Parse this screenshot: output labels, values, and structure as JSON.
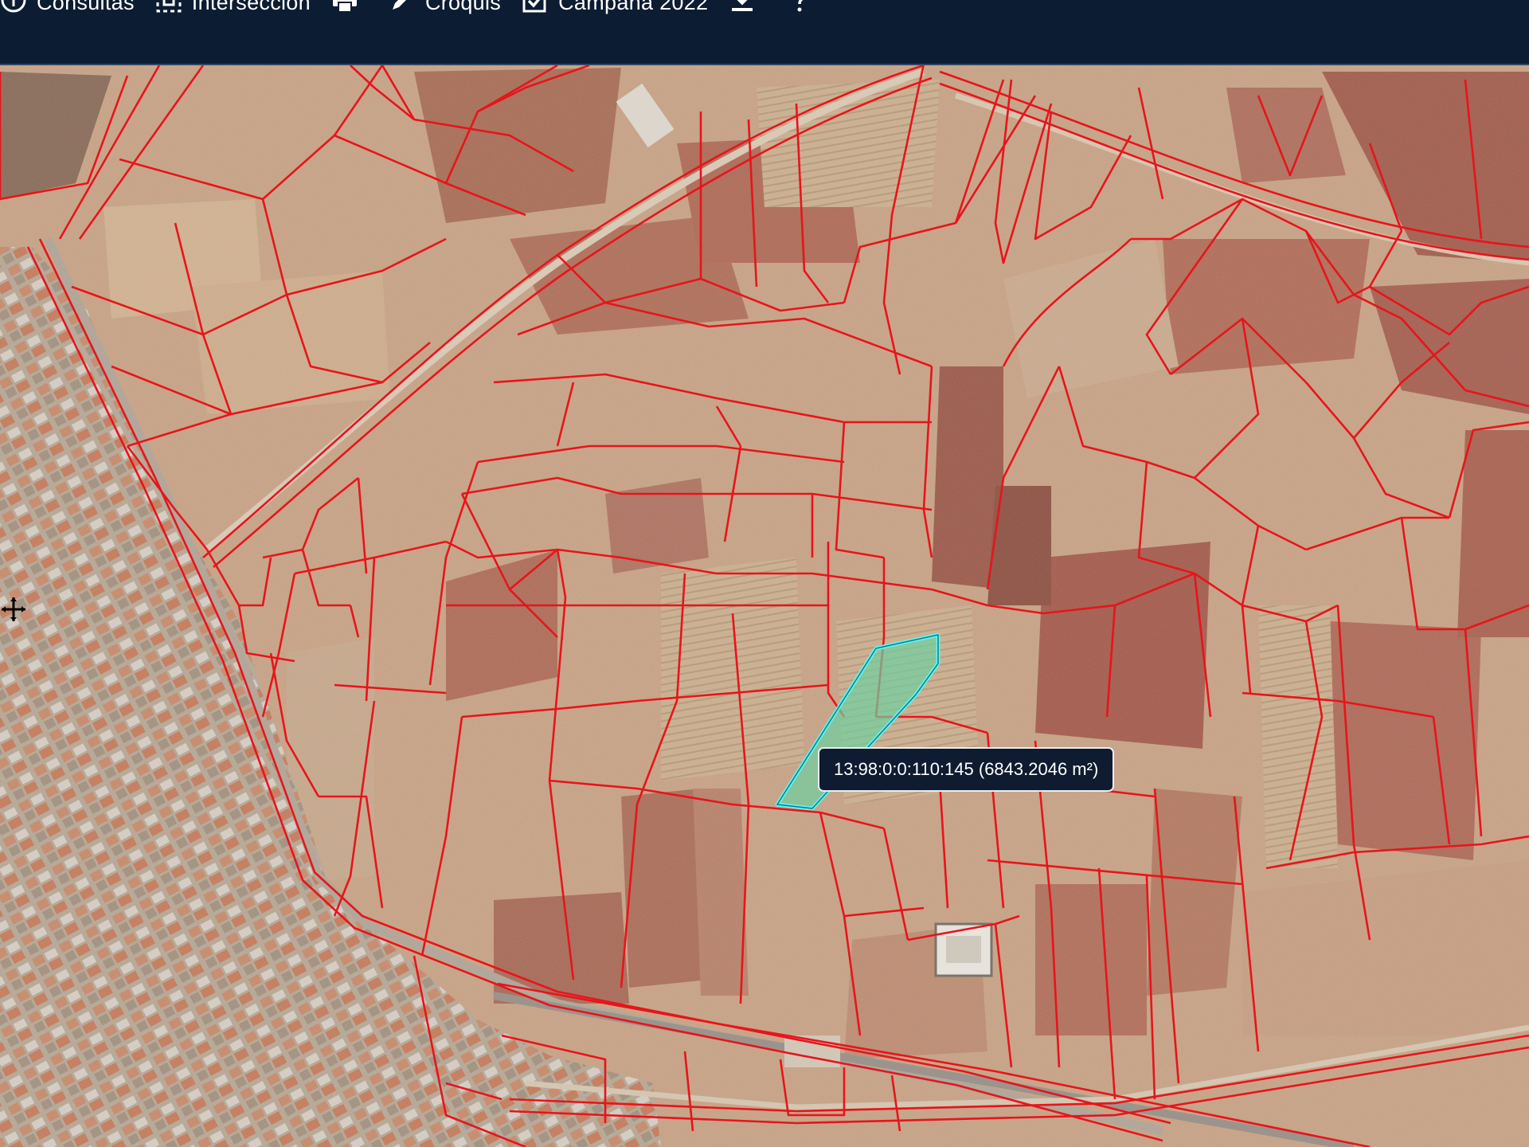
{
  "toolbar": {
    "items": [
      {
        "label": "Consultas",
        "icon": "info-icon"
      },
      {
        "label": "Intersección",
        "icon": "intersection-icon"
      },
      {
        "label": "",
        "icon": "print-icon"
      },
      {
        "label": "Croquis",
        "icon": "pencil-icon"
      },
      {
        "label": "Campaña 2022",
        "icon": "checkbox-icon"
      },
      {
        "label": "",
        "icon": "download-icon"
      },
      {
        "label": "",
        "icon": "help-icon"
      }
    ]
  },
  "map": {
    "selected_parcel": {
      "label": "13:98:0:0:110:145 (6843.2046 m²)",
      "outline_color": "#5ff3f0",
      "fill_color": "#6fcfa0"
    },
    "parcel_line_color": "#e8141b",
    "imagery": "aerial-orthophoto"
  }
}
